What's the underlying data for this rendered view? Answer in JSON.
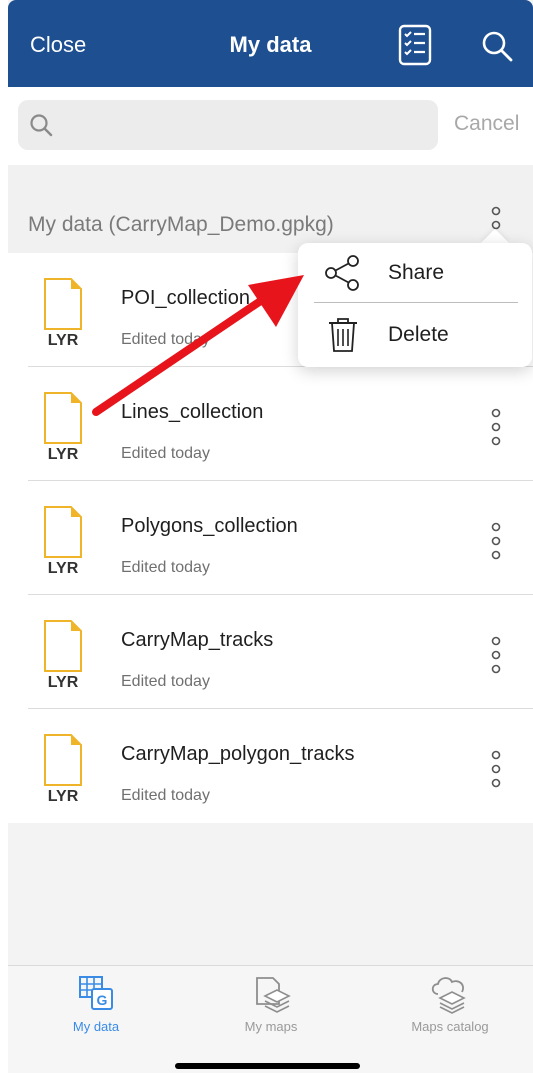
{
  "navbar": {
    "close_label": "Close",
    "title": "My data",
    "checklist_icon": "checklist-icon",
    "search_icon": "search-icon",
    "background": "#1d4f91"
  },
  "search": {
    "placeholder": "",
    "value": "",
    "cancel_label": "Cancel"
  },
  "section": {
    "title": "My data (CarryMap_Demo.gpkg)"
  },
  "layers": [
    {
      "icon_label": "LYR",
      "name": "POI_collection",
      "subtitle": "Edited today"
    },
    {
      "icon_label": "LYR",
      "name": "Lines_collection",
      "subtitle": "Edited today"
    },
    {
      "icon_label": "LYR",
      "name": "Polygons_collection",
      "subtitle": "Edited today"
    },
    {
      "icon_label": "LYR",
      "name": "CarryMap_tracks",
      "subtitle": "Edited today"
    },
    {
      "icon_label": "LYR",
      "name": "CarryMap_polygon_tracks",
      "subtitle": "Edited today"
    }
  ],
  "menu": {
    "items": [
      {
        "label": "Share",
        "icon": "share-icon"
      },
      {
        "label": "Delete",
        "icon": "trash-icon"
      }
    ]
  },
  "tabs": [
    {
      "label": "My data",
      "icon": "my-data-icon",
      "active": true
    },
    {
      "label": "My maps",
      "icon": "my-maps-icon",
      "active": false
    },
    {
      "label": "Maps catalog",
      "icon": "maps-catalog-icon",
      "active": false
    }
  ],
  "colors": {
    "accent": "#3a8be6",
    "file_icon": "#f0b429",
    "annotation_arrow": "#e8141b"
  }
}
